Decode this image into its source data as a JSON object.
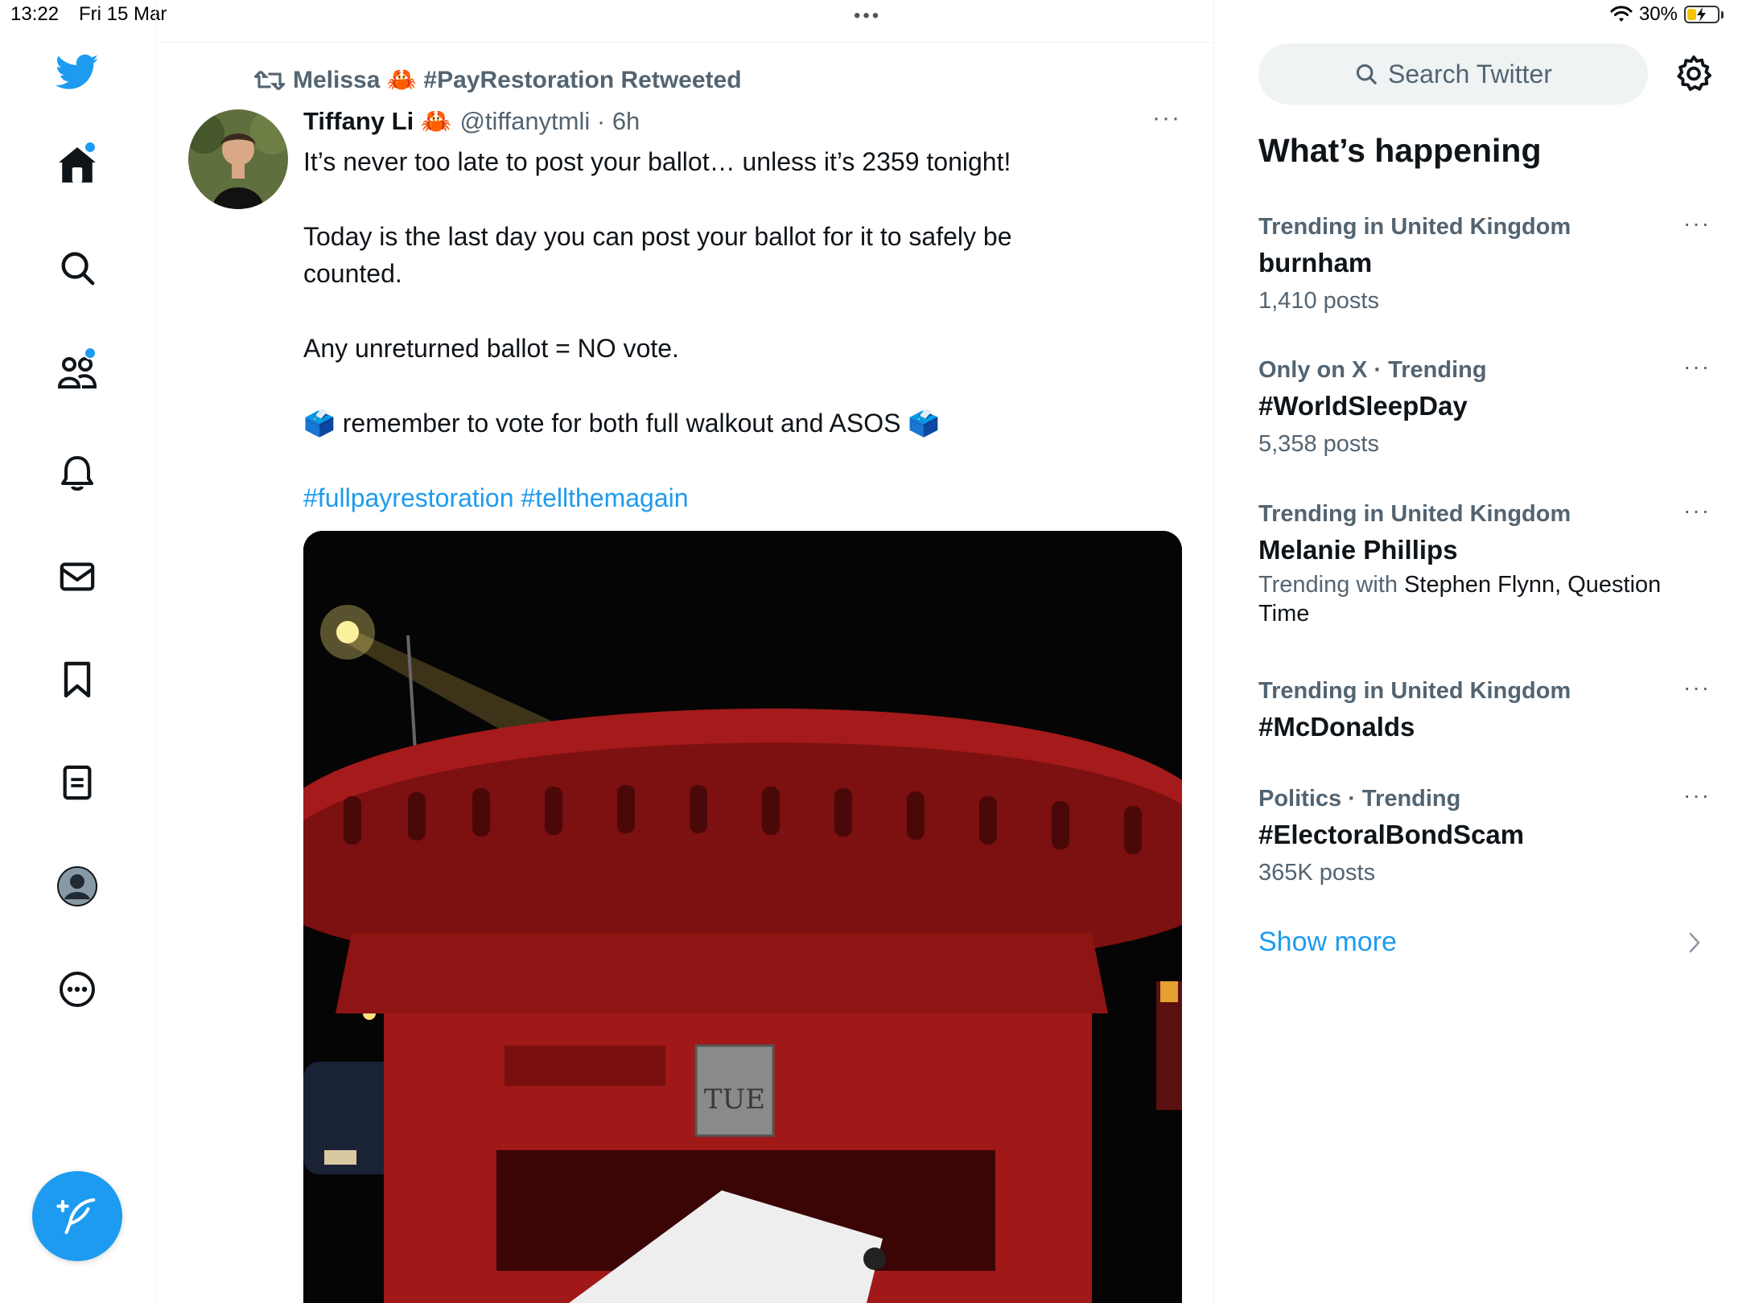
{
  "status_bar": {
    "time": "13:22",
    "date": "Fri 15 Mar",
    "battery": "30%",
    "battery_level": 0.3
  },
  "multitask": {
    "dots": "•••"
  },
  "nav": {
    "items": [
      {
        "name": "twitter-logo-icon"
      },
      {
        "name": "home-icon",
        "has_dot": true
      },
      {
        "name": "search-icon"
      },
      {
        "name": "communities-icon",
        "has_dot": true
      },
      {
        "name": "notifications-icon"
      },
      {
        "name": "messages-icon"
      },
      {
        "name": "bookmarks-icon"
      },
      {
        "name": "lists-icon"
      },
      {
        "name": "profile-icon"
      },
      {
        "name": "more-icon"
      }
    ],
    "compose_icon": "compose-icon"
  },
  "tweet": {
    "retweet_text": "Melissa 🦀 #PayRestoration Retweeted",
    "author_name": "Tiffany Li 🦀",
    "handle_time": "@tiffanytmli · 6h",
    "more": "···",
    "paragraphs": [
      "It’s never too late to post your ballot… unless it’s 2359 tonight!",
      "Today is the last day you can post your ballot for it to safely be counted.",
      "Any unreturned ballot = NO vote.",
      "🗳️ remember to vote for both full walkout and ASOS 🗳️"
    ],
    "hashtags": "#fullpayrestoration #tellthemagain",
    "media_text": "TUE"
  },
  "sidebar": {
    "search_placeholder": "Search Twitter",
    "trends_title": "What’s happening",
    "trends": [
      {
        "context": "Trending in United Kingdom",
        "name": "burnham",
        "count": "1,410 posts"
      },
      {
        "context": "Only on X · Trending",
        "name": "#WorldSleepDay",
        "count": "5,358 posts"
      },
      {
        "context": "Trending in United Kingdom",
        "name": "Melanie Phillips",
        "with_label": "Trending with",
        "with_names": "Stephen Flynn, Question Time"
      },
      {
        "context": "Trending in United Kingdom",
        "name": "#McDonalds"
      },
      {
        "context": "Politics · Trending",
        "name": "#ElectoralBondScam",
        "count": "365K posts"
      }
    ],
    "more": "···",
    "show_more": "Show more"
  },
  "colors": {
    "accent": "#1d9bf0",
    "text": "#0f1419",
    "secondary": "#536471"
  }
}
